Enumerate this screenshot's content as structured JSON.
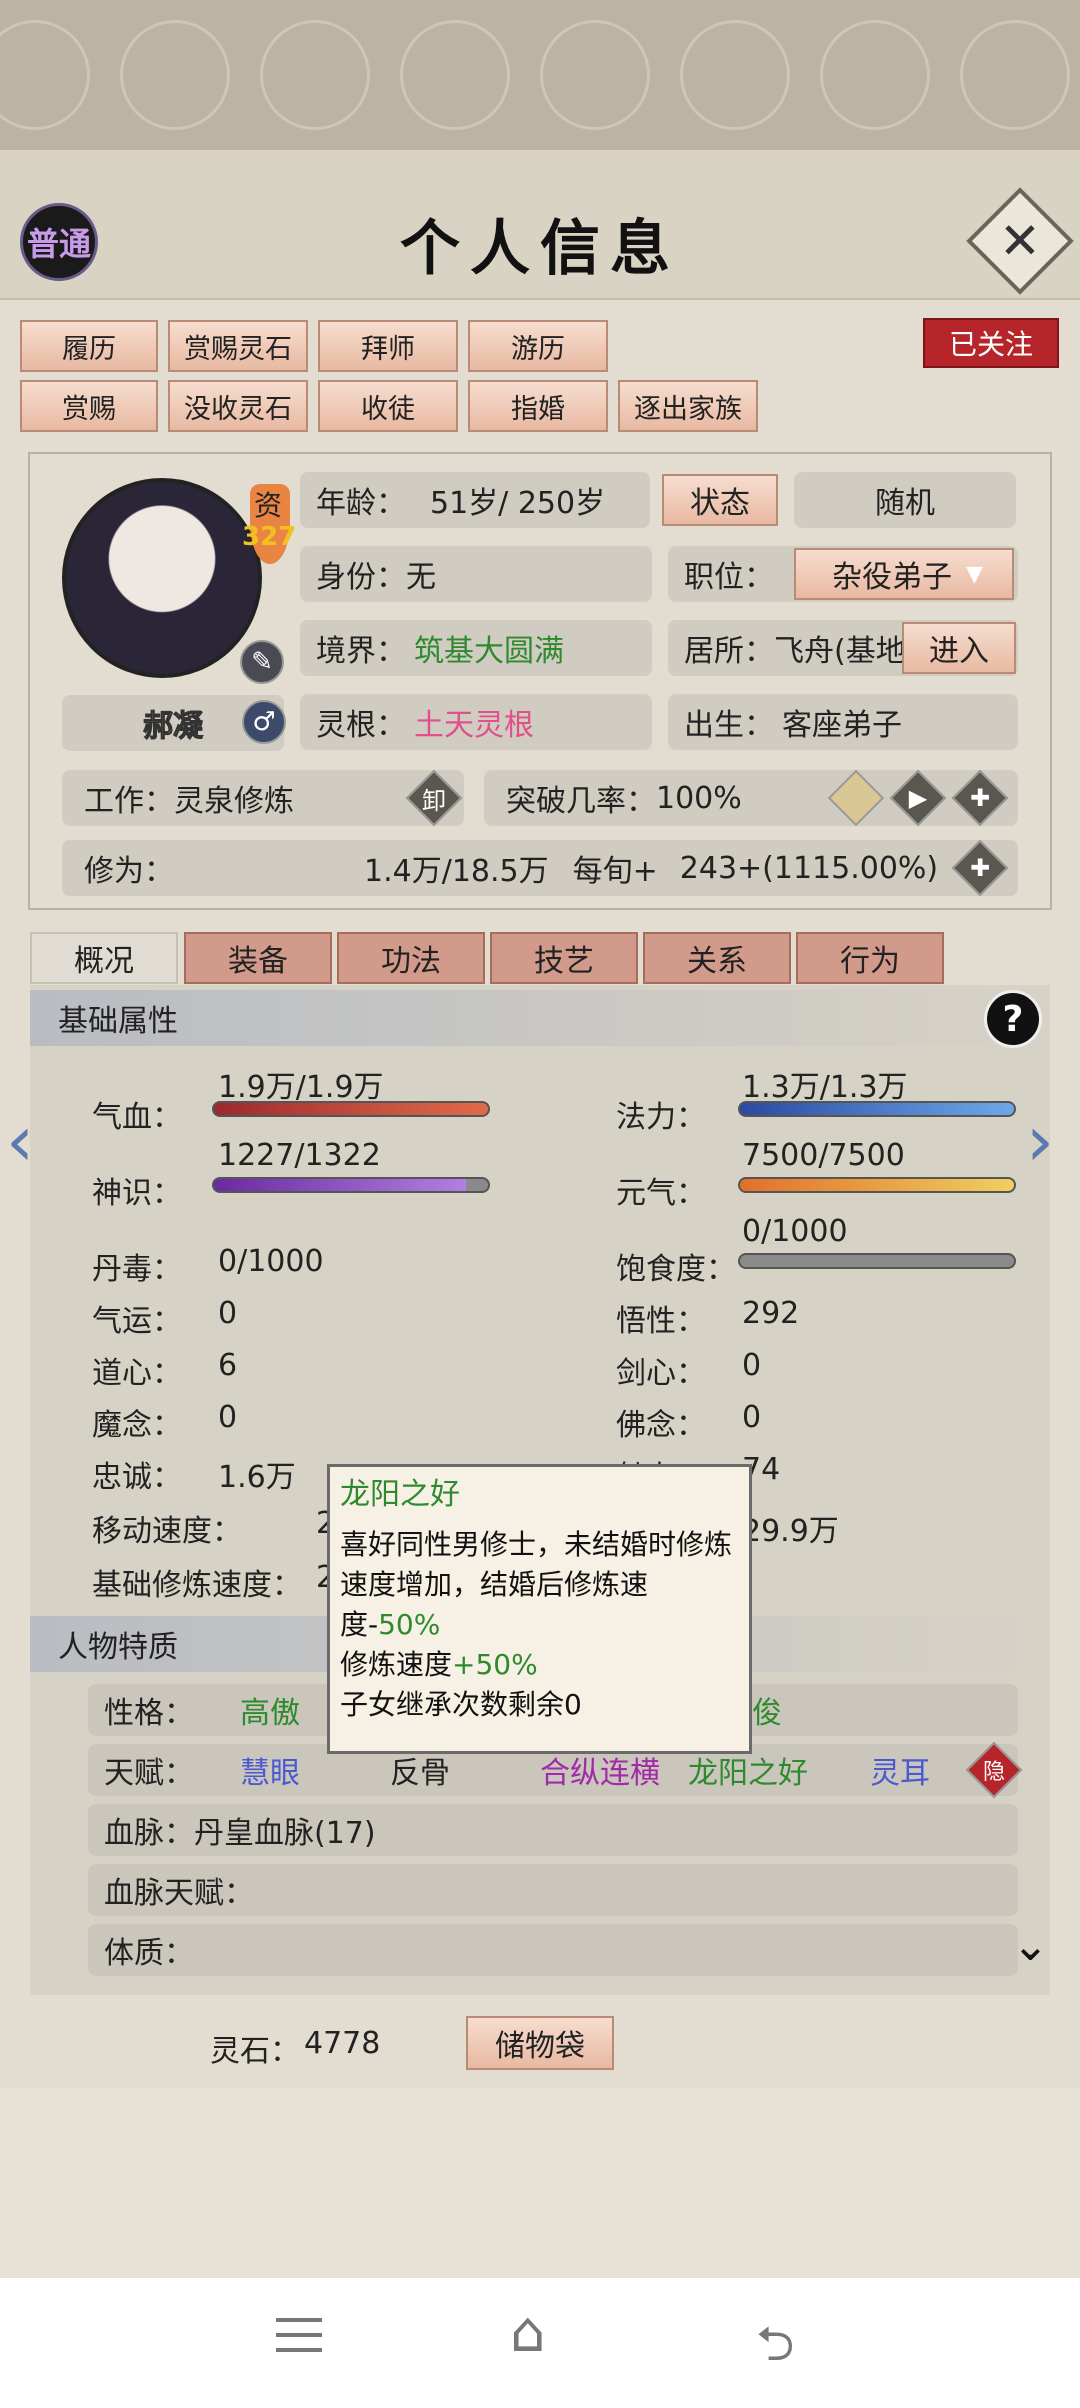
{
  "header": {
    "title": "个人信息",
    "badge": "普通",
    "close_icon": "close-icon"
  },
  "actions_row1": [
    "履历",
    "赏赐灵石",
    "拜师",
    "游历"
  ],
  "actions_row2": [
    "赏赐",
    "没收灵石",
    "收徒",
    "指婚",
    "逐出家族"
  ],
  "follow_label": "已关注",
  "profile": {
    "name": "郝凝",
    "aptitude_label": "资",
    "aptitude_value": "327",
    "age_label": "年龄：",
    "age_value": "51岁/ 250岁",
    "state_btn": "状态",
    "random_btn": "随机",
    "identity_label": "身份：",
    "identity_value": "无",
    "position_label": "职位：",
    "position_value": "杂役弟子",
    "realm_label": "境界：",
    "realm_value": "筑基大圆满",
    "residence_label": "居所：",
    "residence_value": "飞舟(基地",
    "enter_btn": "进入",
    "root_label": "灵根：",
    "root_value": "土天灵根",
    "birth_label": "出生：",
    "birth_value": "客座弟子",
    "work_label": "工作：",
    "work_value": "灵泉修炼",
    "unload_icon_text": "卸",
    "breakthrough_label": "突破几率：",
    "breakthrough_value": "100%",
    "cultivation_label": "修为：",
    "cultivation_value": "1.4万/18.5万",
    "per_turn_label": "每旬+",
    "per_turn_value": "243+(1115.00%)"
  },
  "tabs": [
    "概况",
    "装备",
    "功法",
    "技艺",
    "关系",
    "行为"
  ],
  "basic": {
    "section_title": "基础属性",
    "help": "?",
    "hp_label": "气血：",
    "hp_value": "1.9万/1.9万",
    "mana_label": "法力：",
    "mana_value": "1.3万/1.3万",
    "spirit_label": "神识：",
    "spirit_value": "1227/1322",
    "vitality_label": "元气：",
    "vitality_value": "7500/7500",
    "satiety_value": "0/1000",
    "poison_label": "丹毒：",
    "poison_value": "0/1000",
    "satiety_label": "饱食度：",
    "luck_label": "气运：",
    "luck_value": "0",
    "comprehension_label": "悟性：",
    "comprehension_value": "292",
    "dao_label": "道心：",
    "dao_value": "6",
    "sword_label": "剑心：",
    "sword_value": "0",
    "demon_label": "魔念：",
    "demon_value": "0",
    "buddha_label": "佛念：",
    "buddha_value": "0",
    "loyalty_label": "忠诚：",
    "loyalty_value": "1.6万",
    "charm_partial": "魅力：",
    "charm_value": "74",
    "move_label": "移动速度：",
    "move_partial": "2",
    "right_partial": "29.9万",
    "base_speed_label": "基础修炼速度：",
    "base_speed_partial": "2"
  },
  "traits": {
    "section_title": "人物特质",
    "personality_label": "性格：",
    "personality_value": "高傲",
    "personality_right": "俊",
    "talent_label": "天赋：",
    "talents": [
      "慧眼",
      "反骨",
      "合纵连横",
      "龙阳之好",
      "灵耳"
    ],
    "hidden_badge": "隐",
    "bloodline_label": "血脉：",
    "bloodline_value": "丹皇血脉(17)",
    "bloodline_talent_label": "血脉天赋：",
    "physique_label": "体质："
  },
  "tooltip": {
    "title": "龙阳之好",
    "desc_a": "喜好同性男修士，未结婚时修炼速度增加，结婚后修炼速度-",
    "desc_b": "50%",
    "line2_a": "修炼速度",
    "line2_b": "+50%",
    "line3": "子女继承次数剩余0"
  },
  "footer": {
    "stones_label": "灵石：",
    "stones_value": "4778",
    "bag_btn": "储物袋"
  },
  "colors": {
    "accent_btn": "#e8b9a2",
    "red": "#b5252a",
    "green": "#2f8a2f",
    "pink": "#e0508a"
  }
}
